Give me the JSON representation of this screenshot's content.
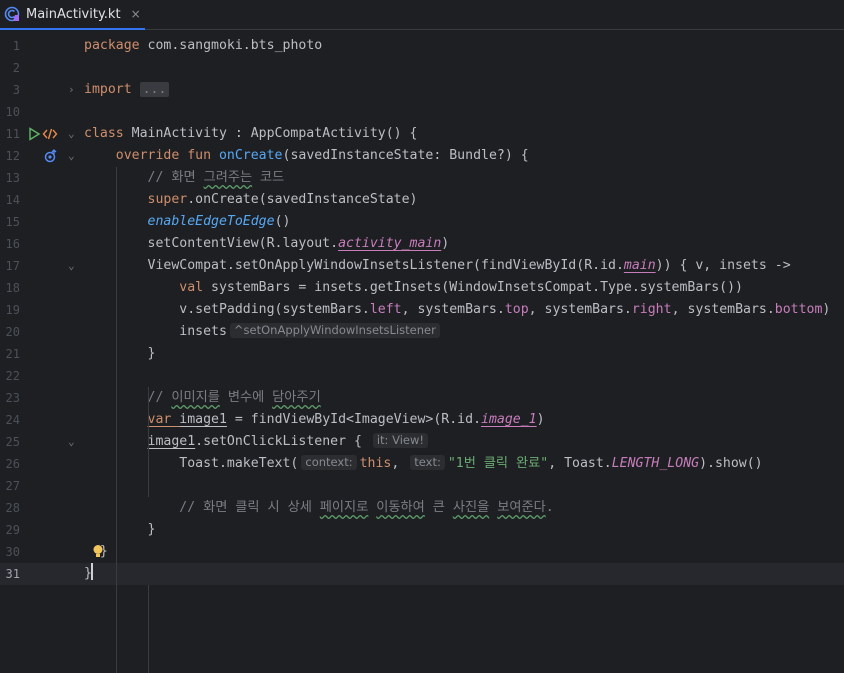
{
  "tab": {
    "label": "MainActivity.kt",
    "close": "×"
  },
  "colors": {
    "accent": "#3574f0",
    "background": "#1e1f22",
    "keyword": "#cf8e6d",
    "function": "#56a8f5",
    "property": "#c77dbb",
    "string": "#6aab73",
    "comment": "#7a7e85"
  },
  "icons": {
    "tab": "kotlin-file-icon",
    "run": "run-gutter-icon",
    "component": "activity-component-icon",
    "override": "override-marker-icon",
    "bulb": "intention-bulb-icon"
  },
  "editor": {
    "current_line": 31,
    "lines": [
      {
        "n": "1",
        "parts": [
          [
            "kw",
            "package "
          ],
          [
            "",
            "com.sangmoki.bts_photo"
          ]
        ]
      },
      {
        "n": "2",
        "parts": []
      },
      {
        "n": "3",
        "parts": [
          [
            "kw",
            "import "
          ],
          [
            "fold-box",
            "..."
          ]
        ]
      },
      {
        "n": "10",
        "parts": []
      },
      {
        "n": "11",
        "parts": [
          [
            "kw",
            "class "
          ],
          [
            "",
            "MainActivity : AppCompatActivity() {"
          ]
        ]
      },
      {
        "n": "12",
        "parts": [
          [
            "",
            "    "
          ],
          [
            "kw",
            "override fun "
          ],
          [
            "fn",
            "onCreate"
          ],
          [
            "",
            "(savedInstanceState: Bundle?) {"
          ]
        ]
      },
      {
        "n": "13",
        "parts": [
          [
            "",
            "        "
          ],
          [
            "cm",
            "// 화면 "
          ],
          [
            "cm typo",
            "그려주는"
          ],
          [
            "cm",
            " 코드"
          ]
        ]
      },
      {
        "n": "14",
        "parts": [
          [
            "",
            "        "
          ],
          [
            "kw",
            "super"
          ],
          [
            "",
            ".onCreate(savedInstanceState)"
          ]
        ]
      },
      {
        "n": "15",
        "parts": [
          [
            "",
            "        "
          ],
          [
            "it-fn",
            "enableEdgeToEdge"
          ],
          [
            "",
            "()"
          ]
        ]
      },
      {
        "n": "16",
        "parts": [
          [
            "",
            "        setContentView(R.layout."
          ],
          [
            "it-prop ul-u",
            "activity_main"
          ],
          [
            "",
            ")"
          ]
        ]
      },
      {
        "n": "17",
        "parts": [
          [
            "",
            "        ViewCompat.setOnApplyWindowInsetsListener(findViewById(R.id."
          ],
          [
            "it-prop ul-u",
            "main"
          ],
          [
            "",
            ")) { v, insets ->"
          ]
        ]
      },
      {
        "n": "18",
        "parts": [
          [
            "",
            "            "
          ],
          [
            "kw",
            "val "
          ],
          [
            "",
            "systemBars = insets.getInsets(WindowInsetsCompat.Type.systemBars())"
          ]
        ]
      },
      {
        "n": "19",
        "parts": [
          [
            "",
            "            v.setPadding(systemBars."
          ],
          [
            "prop",
            "left"
          ],
          [
            "",
            ", systemBars."
          ],
          [
            "prop",
            "top"
          ],
          [
            "",
            ", systemBars."
          ],
          [
            "prop",
            "right"
          ],
          [
            "",
            ", systemBars."
          ],
          [
            "prop",
            "bottom"
          ],
          [
            "",
            ")"
          ]
        ]
      },
      {
        "n": "20",
        "parts": [
          [
            "",
            "            insets"
          ],
          [
            "hint",
            "^setOnApplyWindowInsetsListener"
          ]
        ]
      },
      {
        "n": "21",
        "parts": [
          [
            "",
            "        }"
          ]
        ]
      },
      {
        "n": "22",
        "parts": []
      },
      {
        "n": "23",
        "parts": [
          [
            "",
            "        "
          ],
          [
            "cm",
            "// "
          ],
          [
            "cm typo",
            "이미지를"
          ],
          [
            "cm",
            " 변수에 "
          ],
          [
            "cm typo",
            "담아주기"
          ]
        ]
      },
      {
        "n": "24",
        "parts": [
          [
            "",
            "        "
          ],
          [
            "kw ul-u",
            "var "
          ],
          [
            "ul-u",
            "image1"
          ],
          [
            "",
            " = findViewById<ImageView>(R.id."
          ],
          [
            "it-prop ul-u",
            "image_1"
          ],
          [
            "",
            ")"
          ]
        ]
      },
      {
        "n": "25",
        "parts": [
          [
            "",
            "        "
          ],
          [
            "ul-u",
            "image1"
          ],
          [
            "",
            ".setOnClickListener { "
          ],
          [
            "hint",
            "it: View!"
          ]
        ]
      },
      {
        "n": "26",
        "parts": [
          [
            "",
            "            Toast.makeText("
          ],
          [
            "hint",
            "context:"
          ],
          [
            "kw",
            "this"
          ],
          [
            "",
            ", "
          ],
          [
            "hint",
            "text:"
          ],
          [
            "str",
            "\"1번 클릭 완료\""
          ],
          [
            "",
            ", Toast."
          ],
          [
            "it-prop",
            "LENGTH_LONG"
          ],
          [
            "",
            ").show()"
          ]
        ]
      },
      {
        "n": "27",
        "parts": []
      },
      {
        "n": "28",
        "parts": [
          [
            "",
            "            "
          ],
          [
            "cm",
            "// 화면 클릭 시 상세 "
          ],
          [
            "cm typo",
            "페이지로"
          ],
          [
            "cm",
            " "
          ],
          [
            "cm typo",
            "이동하여"
          ],
          [
            "cm",
            " 큰 "
          ],
          [
            "cm typo",
            "사진을"
          ],
          [
            "cm",
            " "
          ],
          [
            "cm typo",
            "보여준다"
          ],
          [
            "cm",
            "."
          ]
        ]
      },
      {
        "n": "29",
        "parts": [
          [
            "",
            "        }"
          ]
        ]
      },
      {
        "n": "30",
        "parts": [
          [
            "",
            "  }"
          ]
        ]
      },
      {
        "n": "31",
        "parts": [
          [
            "",
            "}"
          ]
        ]
      }
    ]
  }
}
